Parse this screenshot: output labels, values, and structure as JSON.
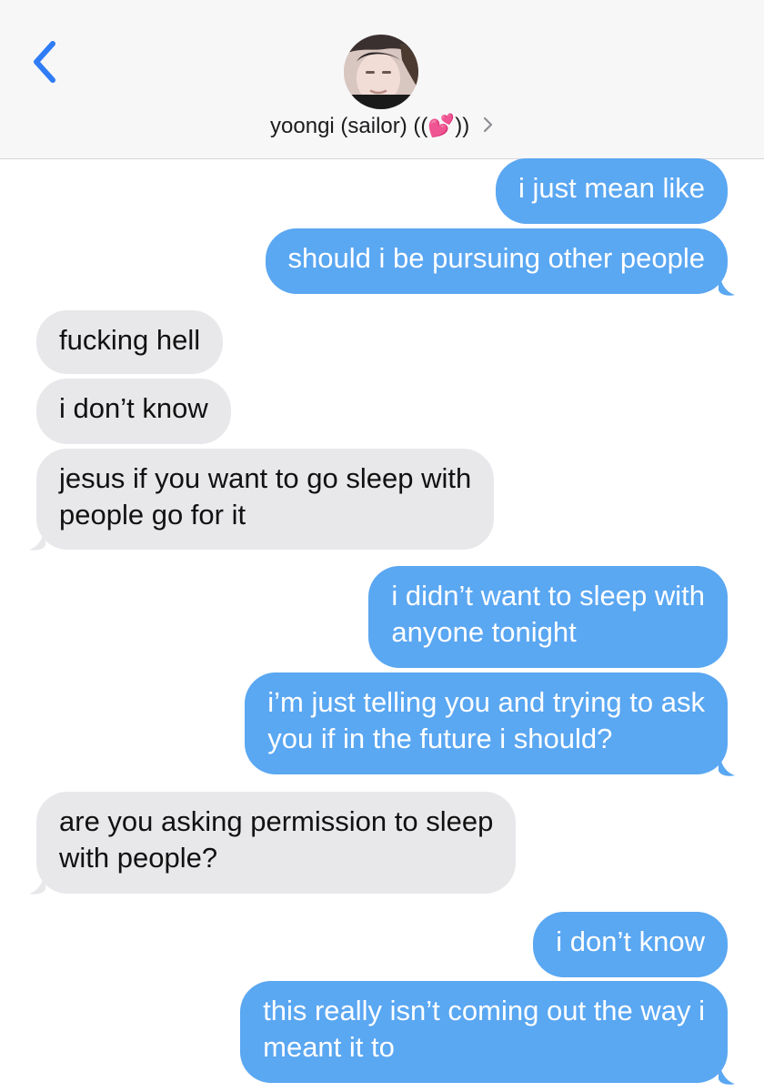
{
  "header": {
    "contact_name": "yoongi (sailor) ((💕))",
    "back_icon": "chevron-left-icon",
    "detail_icon": "chevron-right-icon"
  },
  "colors": {
    "outgoing_bubble": "#5aa7f2",
    "incoming_bubble": "#e8e8eb",
    "accent": "#2f7cf6"
  },
  "messages": [
    {
      "direction": "outgoing",
      "text": "i just mean like"
    },
    {
      "direction": "outgoing",
      "text": "should i be pursuing other people"
    },
    {
      "direction": "incoming",
      "text": "fucking hell"
    },
    {
      "direction": "incoming",
      "text": "i don’t know"
    },
    {
      "direction": "incoming",
      "text": "jesus if you want to go sleep with\npeople go for it"
    },
    {
      "direction": "outgoing",
      "text": "i didn’t want to sleep with\nanyone tonight"
    },
    {
      "direction": "outgoing",
      "text": "i’m just telling you and trying to ask\nyou if in the future i should?"
    },
    {
      "direction": "incoming",
      "text": "are you asking permission to sleep\nwith people?"
    },
    {
      "direction": "outgoing",
      "text": "i don’t know"
    },
    {
      "direction": "outgoing",
      "text": "this really isn’t coming out the way i\nmeant it to"
    }
  ]
}
